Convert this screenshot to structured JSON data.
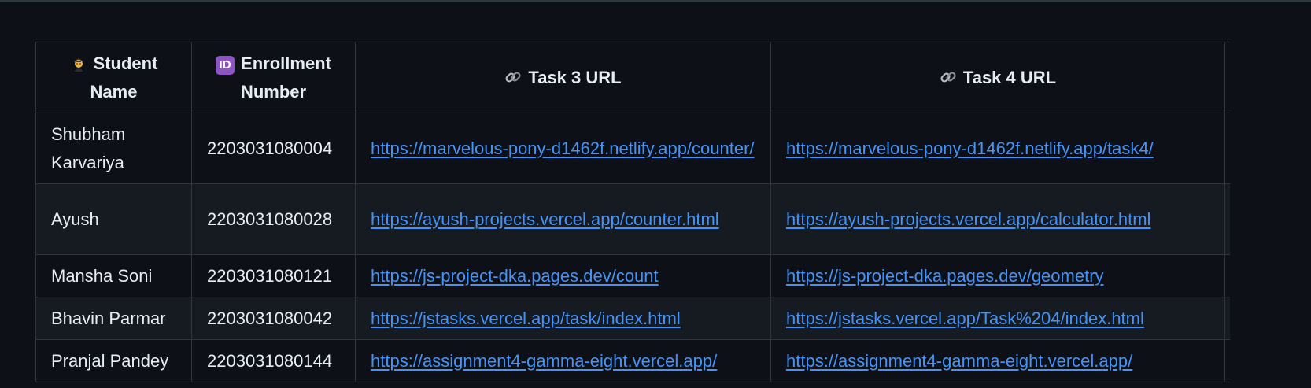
{
  "table": {
    "headers": {
      "student_name": {
        "icon": "student-icon",
        "label": "Student Name"
      },
      "enrollment": {
        "icon": "id-icon",
        "icon_text": "ID",
        "label": "Enrollment Number"
      },
      "task3": {
        "icon": "link-icon",
        "label": "Task 3 URL"
      },
      "task4": {
        "icon": "link-icon",
        "label": "Task 4 URL"
      }
    },
    "rows": [
      {
        "name": "Shubham Karvariya",
        "enrollment": "2203031080004",
        "task3": "https://marvelous-pony-d1462f.netlify.app/counter/",
        "task4": "https://marvelous-pony-d1462f.netlify.app/task4/"
      },
      {
        "name": "Ayush",
        "enrollment": "2203031080028",
        "task3": "https://ayush-projects.vercel.app/counter.html",
        "task4": "https://ayush-projects.vercel.app/calculator.html"
      },
      {
        "name": "Mansha Soni",
        "enrollment": "2203031080121",
        "task3": "https://js-project-dka.pages.dev/count",
        "task4": "https://js-project-dka.pages.dev/geometry"
      },
      {
        "name": "Bhavin Parmar",
        "enrollment": "2203031080042",
        "task3": "https://jstasks.vercel.app/task/index.html",
        "task4": "https://jstasks.vercel.app/Task%204/index.html"
      },
      {
        "name": "Pranjal Pandey",
        "enrollment": "2203031080144",
        "task3": "https://assignment4-gamma-eight.vercel.app/",
        "task4": "https://assignment4-gamma-eight.vercel.app/"
      }
    ]
  },
  "colors": {
    "background": "#0d1117",
    "row_alt": "#161b22",
    "border": "#30363d",
    "link": "#4493f8",
    "text": "#e6edf3"
  }
}
